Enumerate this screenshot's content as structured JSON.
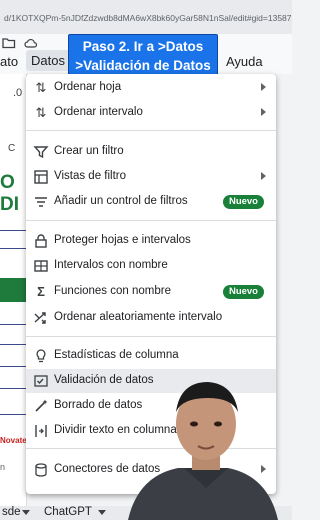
{
  "browser": {
    "url": "d/1KOTXQPm-5nJDfZdzwdb8dMA6wX8bk60yGar58N1nSal/edit#gid=13587"
  },
  "menubar": {
    "items": [
      {
        "label": "ato"
      },
      {
        "label": "Datos"
      },
      {
        "label": "Ayuda"
      }
    ]
  },
  "callout": {
    "line1": "Paso 2. Ir a >Datos",
    "line2": ">Validación de Datos"
  },
  "sheet": {
    "col_header": "C",
    "dot": ".0",
    "title_fragment": "O DI",
    "footer_red": "Novate",
    "footer_gray": "n"
  },
  "dropdown": {
    "items": [
      {
        "label": "Ordenar hoja",
        "icon": "sort-icon",
        "submenu": true
      },
      {
        "label": "Ordenar intervalo",
        "icon": "sort-icon",
        "submenu": true
      },
      {
        "label": "Crear un filtro",
        "icon": "filter-icon"
      },
      {
        "label": "Vistas de filtro",
        "icon": "grid-icon",
        "submenu": true
      },
      {
        "label": "Añadir un control de filtros",
        "icon": "filter-list-icon",
        "badge": "Nuevo"
      },
      {
        "label": "Proteger hojas e intervalos",
        "icon": "lock-icon"
      },
      {
        "label": "Intervalos con nombre",
        "icon": "table-icon"
      },
      {
        "label": "Funciones con nombre",
        "icon": "sigma-icon",
        "badge": "Nuevo"
      },
      {
        "label": "Ordenar aleatoriamente intervalo",
        "icon": "shuffle-icon"
      },
      {
        "label": "Estadísticas de columna",
        "icon": "lightbulb-icon"
      },
      {
        "label": "Validación de datos",
        "icon": "data-validation-icon"
      },
      {
        "label": "Borrado de datos",
        "icon": "magic-wand-icon"
      },
      {
        "label": "Dividir texto en columnas",
        "icon": "split-columns-icon"
      },
      {
        "label": "Conectores de datos",
        "icon": "database-icon",
        "submenu": true
      }
    ]
  },
  "bottom_tabs": [
    {
      "label": "sde"
    },
    {
      "label": "ChatGPT"
    }
  ],
  "colors": {
    "callout_bg": "#1a73e8",
    "badge_bg": "#188038",
    "sheet_green": "#1e7b3b",
    "highlight": "#e8eaed"
  }
}
